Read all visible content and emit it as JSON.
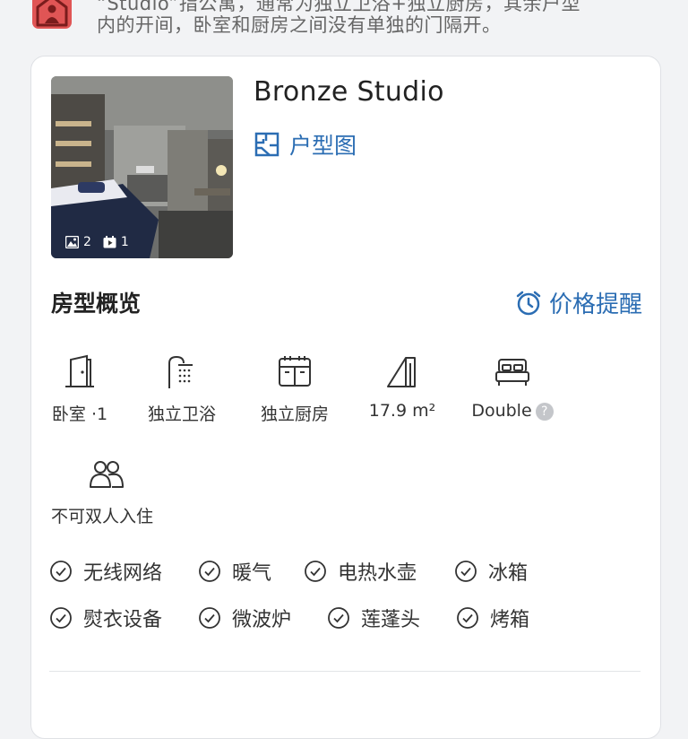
{
  "top_note": {
    "line1": "“Studio”指公寓，通常为独立卫浴+独立厨房，其余户型",
    "line2": "内的开间，卧室和厨房之间没有单独的门隔开。"
  },
  "room": {
    "title": "Bronze Studio",
    "floorplan_label": "户型图",
    "photo_count": "2",
    "video_count": "1"
  },
  "overview": {
    "title": "房型概览",
    "price_alert_label": "价格提醒"
  },
  "features": [
    {
      "icon": "door-icon",
      "label": "卧室 ·1"
    },
    {
      "icon": "shower-icon",
      "label": "独立卫浴"
    },
    {
      "icon": "kitchen-icon",
      "label": "独立厨房"
    },
    {
      "icon": "area-icon",
      "label": "17.9 m²"
    },
    {
      "icon": "bed-icon",
      "label": "Double"
    },
    {
      "icon": "people-icon",
      "label": "不可双人入住"
    }
  ],
  "amenities": [
    "无线网络",
    "暖气",
    "电热水壶",
    "冰箱",
    "熨衣设备",
    "微波炉",
    "莲蓬头",
    "烤箱"
  ],
  "colors": {
    "accent": "#2b6db3",
    "house_icon": "#e05555"
  }
}
